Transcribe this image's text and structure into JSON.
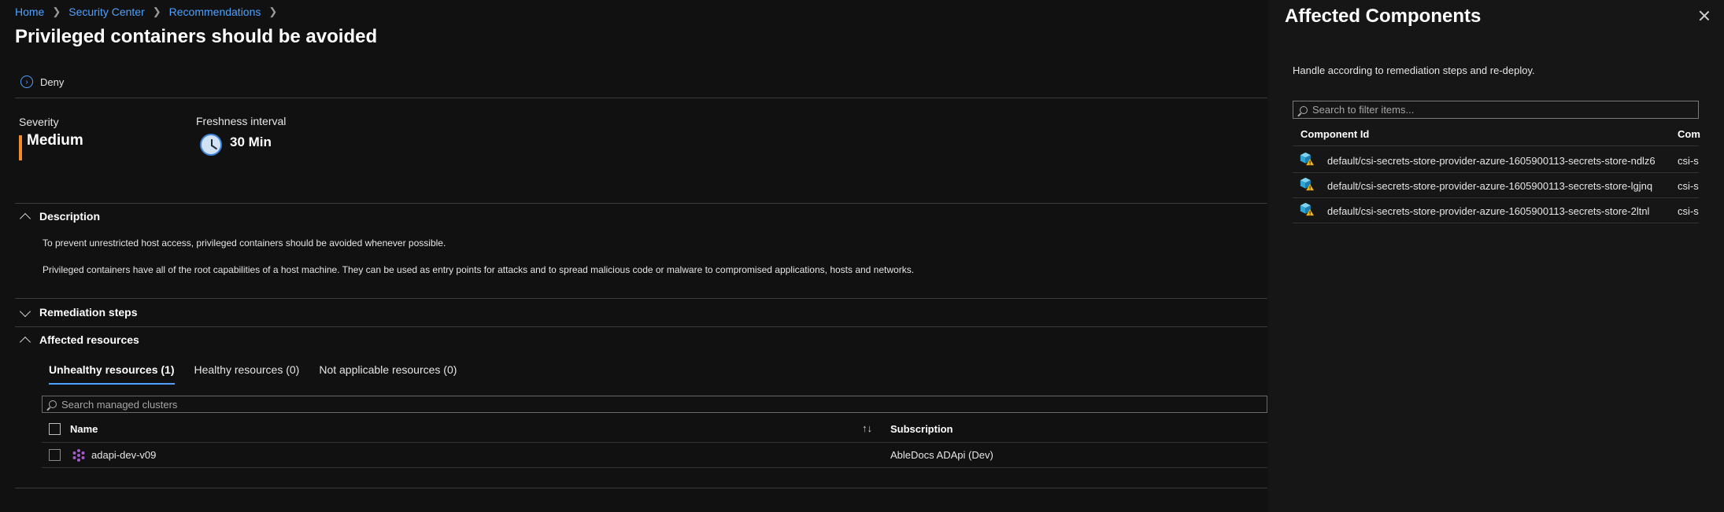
{
  "breadcrumb": [
    "Home",
    "Security Center",
    "Recommendations"
  ],
  "page_title": "Privileged containers should be avoided",
  "toolbar": {
    "deny_label": "Deny"
  },
  "severity": {
    "label": "Severity",
    "value": "Medium",
    "color": "#f08c2a"
  },
  "freshness": {
    "label": "Freshness interval",
    "value": "30 Min"
  },
  "description": {
    "heading": "Description",
    "paragraphs": [
      "To prevent unrestricted host access, privileged containers should be avoided whenever possible.",
      "Privileged containers have all of the root capabilities of a host machine. They can be used as entry points for attacks and to spread malicious code or malware to compromised applications, hosts and networks."
    ]
  },
  "remediation": {
    "heading": "Remediation steps"
  },
  "affected": {
    "heading": "Affected resources",
    "tabs": [
      "Unhealthy resources (1)",
      "Healthy resources (0)",
      "Not applicable resources (0)"
    ],
    "search_placeholder": "Search managed clusters",
    "columns": {
      "name": "Name",
      "subscription": "Subscription"
    },
    "rows": [
      {
        "name": "adapi-dev-v09",
        "subscription": "AbleDocs ADApi (Dev)"
      }
    ]
  },
  "panel": {
    "title": "Affected Components",
    "description": "Handle according to remediation steps and re-deploy.",
    "search_placeholder": "Search to filter items...",
    "columns": {
      "component_id": "Component Id",
      "second": "Com"
    },
    "rows": [
      {
        "id": "default/csi-secrets-store-provider-azure-1605900113-secrets-store-ndlz6",
        "second": "csi-s"
      },
      {
        "id": "default/csi-secrets-store-provider-azure-1605900113-secrets-store-lgjnq",
        "second": "csi-s"
      },
      {
        "id": "default/csi-secrets-store-provider-azure-1605900113-secrets-store-2ltnl",
        "second": "csi-s"
      }
    ]
  },
  "colors": {
    "accent": "#4ea1ff",
    "background": "#111111",
    "panel_background": "#161616",
    "warning": "#f2b705"
  },
  "icons": [
    "chevron-right-icon",
    "deny-circle-icon",
    "clock-icon",
    "chevron-up-icon",
    "chevron-down-icon",
    "search-icon",
    "sort-icon",
    "kubernetes-cluster-icon",
    "container-warning-icon",
    "close-icon"
  ]
}
